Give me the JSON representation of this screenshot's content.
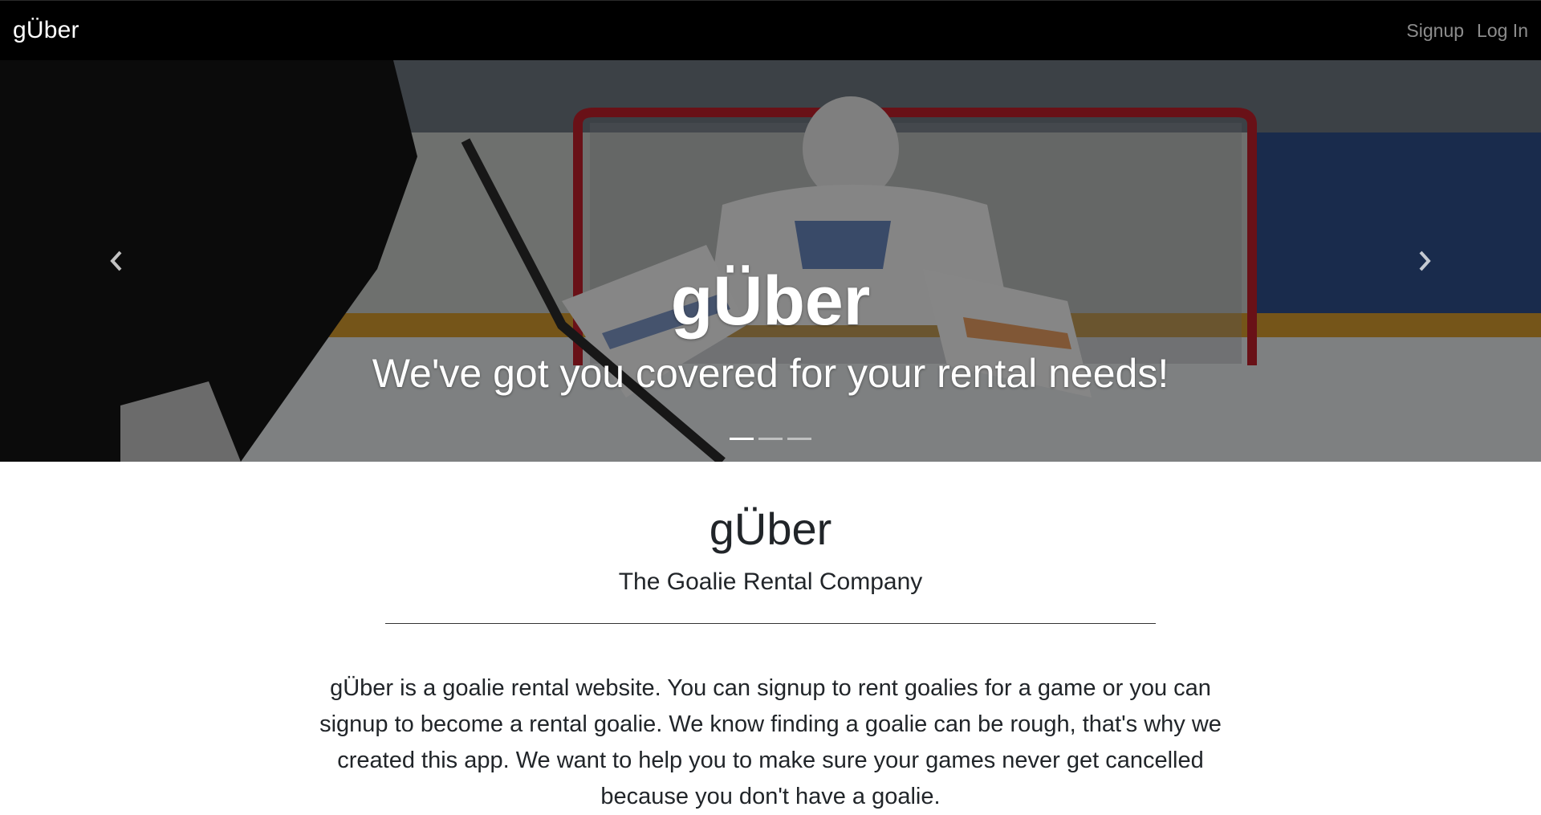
{
  "navbar": {
    "brand": "gÜber",
    "links": [
      {
        "label": "Signup"
      },
      {
        "label": "Log In"
      }
    ]
  },
  "carousel": {
    "title": "gÜber",
    "subtitle": "We've got you covered for your rental needs!",
    "slide_count": 3,
    "active_slide": 1,
    "prev_icon": "chevron-left-icon",
    "next_icon": "chevron-right-icon"
  },
  "main": {
    "title": "gÜber",
    "subtitle": "The Goalie Rental Company",
    "about": "gÜber is a goalie rental website. You can signup to rent goalies for a game or you can signup to become a rental goalie. We know finding a goalie can be rough, that's why we created this app. We want to help you to make sure your games never get cancelled because you don't have a goalie."
  },
  "colors": {
    "navbar_bg": "#000000",
    "nav_link": "#8c8c8c",
    "net_red": "#c0202a",
    "text": "#212529"
  }
}
